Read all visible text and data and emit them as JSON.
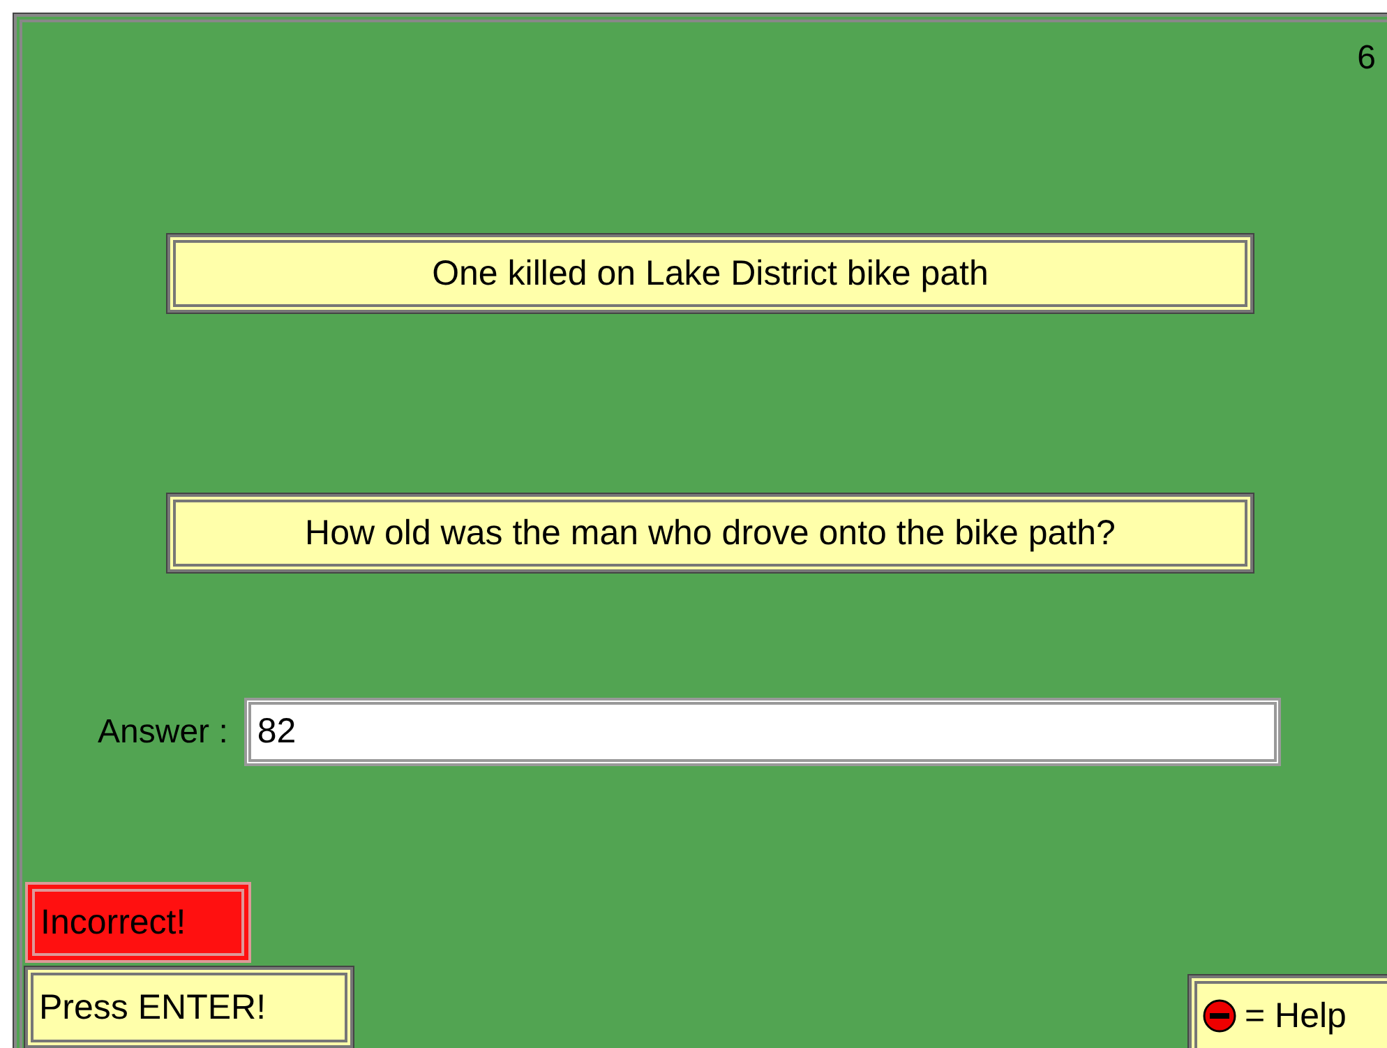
{
  "counter": "6",
  "headline": "One killed on Lake District bike path",
  "question": "How old was the man who drove onto the bike path?",
  "answer": {
    "label": "Answer :",
    "value": "82"
  },
  "result": {
    "text": "Incorrect!",
    "correct": false
  },
  "prompt": "Press ENTER!",
  "help": {
    "text": "= Help"
  }
}
